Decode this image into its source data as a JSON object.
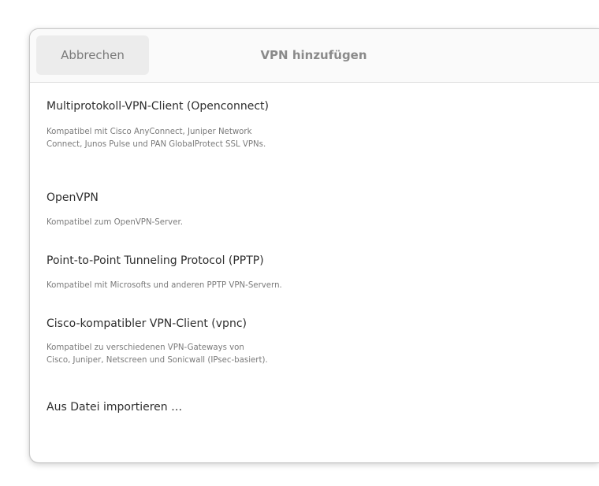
{
  "dialog": {
    "title": "VPN hinzufügen",
    "cancel_label": "Abbrechen"
  },
  "options": [
    {
      "title": "Multiprotokoll-VPN-Client (Openconnect)",
      "description_lines": [
        "Kompatibel mit Cisco AnyConnect, Juniper Network",
        "Connect, Junos Pulse und PAN GlobalProtect SSL VPNs."
      ]
    },
    {
      "title": "OpenVPN",
      "description_lines": [
        "Kompatibel zum OpenVPN-Server."
      ]
    },
    {
      "title": "Point-to-Point Tunneling Protocol (PPTP)",
      "description_lines": [
        "Kompatibel mit Microsofts und anderen PPTP VPN-Servern."
      ]
    },
    {
      "title": "Cisco-kompatibler VPN-Client (vpnc)",
      "description_lines": [
        "Kompatibel zu verschiedenen VPN-Gateways von",
        "Cisco, Juniper, Netscreen und Sonicwall (IPsec-basiert)."
      ]
    }
  ],
  "import_label": "Aus Datei importieren …"
}
